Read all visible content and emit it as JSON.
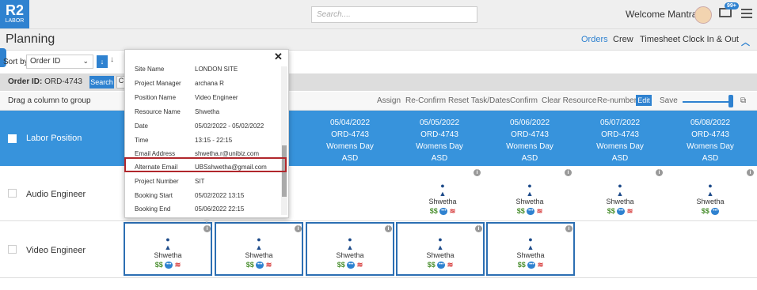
{
  "app": {
    "logo_main": "R2",
    "logo_sub": "LABOR",
    "search_placeholder": "Search....",
    "welcome": "Welcome Mantra",
    "notif_count": "99+"
  },
  "subnav": {
    "title": "Planning",
    "links": [
      "Orders",
      "Crew",
      "Timesheet",
      "Clock In & Out"
    ]
  },
  "sort": {
    "label": "Sort by",
    "value": "Order ID"
  },
  "order": {
    "label": "Order ID:",
    "value": "ORD-4743",
    "search_btn": "Search",
    "extra_btn": "C"
  },
  "toolbar": {
    "drag_hint": "Drag a column to group",
    "actions": [
      "Assign",
      "Re-Confirm",
      "Reset Task/Dates",
      "Confirm",
      "Clear Resource",
      "Re-number"
    ],
    "edit": "Edit",
    "save": "Save"
  },
  "grid": {
    "header_label": "Labor Position",
    "dates": [
      {
        "date": "05/04/2022",
        "order": "ORD-4743",
        "event": "Womens Day",
        "code": "ASD"
      },
      {
        "date": "05/05/2022",
        "order": "ORD-4743",
        "event": "Womens Day",
        "code": "ASD"
      },
      {
        "date": "05/06/2022",
        "order": "ORD-4743",
        "event": "Womens Day",
        "code": "ASD"
      },
      {
        "date": "05/07/2022",
        "order": "ORD-4743",
        "event": "Womens Day",
        "code": "ASD"
      },
      {
        "date": "05/08/2022",
        "order": "ORD-4743",
        "event": "Womens Day",
        "code": "ASD"
      }
    ],
    "rows": [
      {
        "label": "Audio Engineer"
      },
      {
        "label": "Video Engineer"
      }
    ],
    "cell": {
      "name": "Shwetha",
      "dollar": "$$",
      "info": "i"
    }
  },
  "popup": {
    "rows": [
      {
        "k": "Site Name",
        "v": "LONDON SITE"
      },
      {
        "k": "Project Manager",
        "v": "archana R"
      },
      {
        "k": "Position Name",
        "v": "Video Engineer"
      },
      {
        "k": "Resource Name",
        "v": "Shwetha"
      },
      {
        "k": "Date",
        "v": "05/02/2022 - 05/02/2022"
      },
      {
        "k": "Time",
        "v": "13:15 - 22:15"
      },
      {
        "k": "Email Address",
        "v": "shwetha.r@unibiz.com"
      },
      {
        "k": "Alternate Email",
        "v": "UBSshwetha@gmail.com"
      },
      {
        "k": "Project Number",
        "v": "SIT"
      },
      {
        "k": "Booking Start",
        "v": "05/02/2022 13:15"
      },
      {
        "k": "Booking End",
        "v": "05/06/2022 22:15"
      }
    ]
  }
}
